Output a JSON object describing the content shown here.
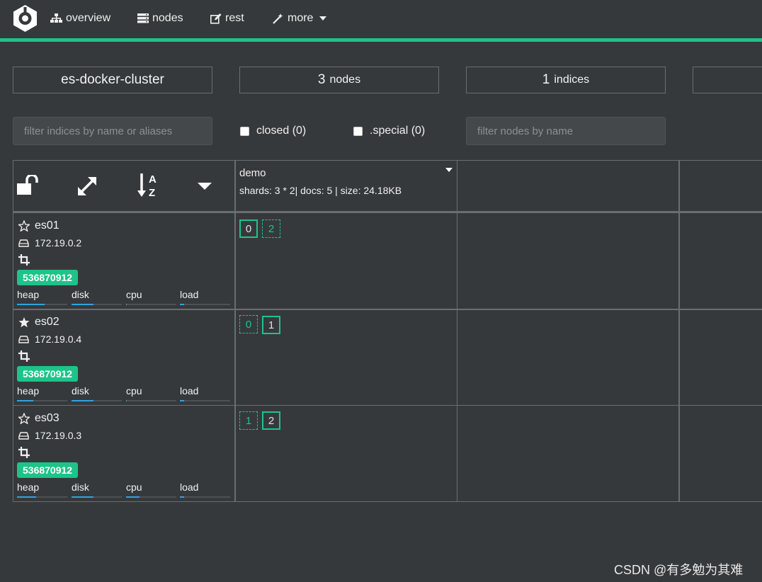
{
  "nav": {
    "items": [
      {
        "label": "overview",
        "icon": "sitemap-icon"
      },
      {
        "label": "nodes",
        "icon": "server-icon"
      },
      {
        "label": "rest",
        "icon": "edit-icon"
      },
      {
        "label": "more",
        "icon": "magic-wand-icon"
      }
    ]
  },
  "stats": {
    "cluster_name": "es-docker-cluster",
    "nodes_count": "3",
    "nodes_label": "nodes",
    "indices_count": "1",
    "indices_label": "indices"
  },
  "filters": {
    "indices_placeholder": "filter indices by name or aliases",
    "closed_label": "closed (0)",
    "special_label": ".special (0)",
    "nodes_placeholder": "filter nodes by name",
    "closed_checked": false,
    "special_checked": false
  },
  "index": {
    "name": "demo",
    "meta": "shards: 3 * 2| docs: 5 | size: 24.18KB"
  },
  "nodes": [
    {
      "name": "es01",
      "ip": "172.19.0.2",
      "master": false,
      "badge": "536870912",
      "metrics": {
        "heap": 0.55,
        "disk": 0.43,
        "cpu": 0.02,
        "load": 0.08
      },
      "shards": [
        {
          "num": "0",
          "type": "primary"
        },
        {
          "num": "2",
          "type": "replica"
        }
      ]
    },
    {
      "name": "es02",
      "ip": "172.19.0.4",
      "master": true,
      "badge": "536870912",
      "metrics": {
        "heap": 0.32,
        "disk": 0.43,
        "cpu": 0.02,
        "load": 0.08
      },
      "shards": [
        {
          "num": "0",
          "type": "replica"
        },
        {
          "num": "1",
          "type": "primary"
        }
      ]
    },
    {
      "name": "es03",
      "ip": "172.19.0.3",
      "master": false,
      "badge": "536870912",
      "metrics": {
        "heap": 0.38,
        "disk": 0.43,
        "cpu": 0.27,
        "load": 0.08
      },
      "shards": [
        {
          "num": "1",
          "type": "replica"
        },
        {
          "num": "2",
          "type": "primary"
        }
      ]
    }
  ],
  "metric_labels": {
    "heap": "heap",
    "disk": "disk",
    "cpu": "cpu",
    "load": "load"
  },
  "colors": {
    "accent": "#1ec38a",
    "background": "#36393c",
    "metric_fill": "#2fa3e0"
  },
  "watermark": "CSDN @有多勉为其难"
}
